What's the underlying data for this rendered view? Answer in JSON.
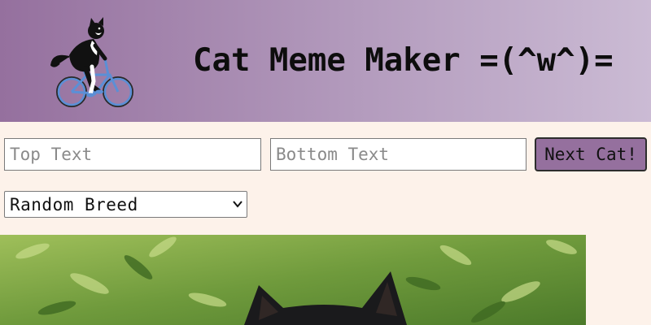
{
  "header": {
    "title": "Cat Meme Maker =(^w^)=",
    "logo_icon": "cat-on-bicycle-icon"
  },
  "controls": {
    "top_text_placeholder": "Top Text",
    "bottom_text_placeholder": "Bottom Text",
    "next_button_label": "Next Cat!",
    "breed_selected": "Random Breed"
  },
  "meme": {
    "image_subject": "black cat in green foliage"
  },
  "colors": {
    "header_start": "#95709e",
    "header_end": "#cbbbd4",
    "page_background": "#fdf2ea",
    "button_background": "#95709e",
    "bicycle": "#5b8fd6"
  }
}
